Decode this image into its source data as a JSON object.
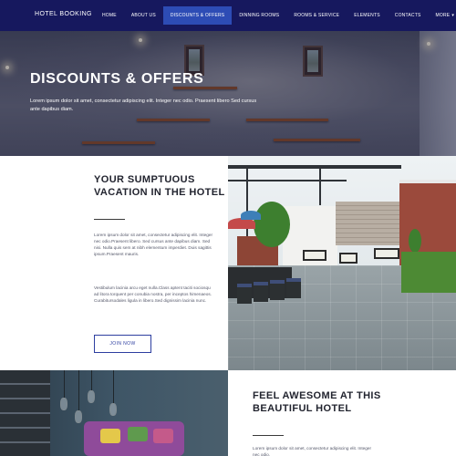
{
  "nav": {
    "brand": "HOTEL BOOKING",
    "items": [
      {
        "label": "HOME"
      },
      {
        "label": "ABOUT US"
      },
      {
        "label": "DISCOUNTS & OFFERS",
        "active": true
      },
      {
        "label": "DINNING ROOMS"
      },
      {
        "label": "ROOMS & SERVICE"
      },
      {
        "label": "ELEMENTS"
      },
      {
        "label": "CONTACTS"
      },
      {
        "label": "MORE"
      }
    ],
    "more_caret": "▾",
    "colors": {
      "bar": "#16185e",
      "active": "#2d4cb5"
    }
  },
  "hero": {
    "title": "DISCOUNTS & OFFERS",
    "text": "Lorem ipsum dolor sit amet, consectetur adipiscing elit. Integer nec odio. Praesent libero Sed cursus ante dapibus diam."
  },
  "section1": {
    "heading": "YOUR SUMPTUOUS VACATION IN THE HOTEL",
    "para1": "Lorem ipsum dolor sit amet, consectetur adipiscing elit. Integer nec odio.Praesent libero. Sed cursus ante dapibus diam. Sed nisi. Nulla quis sem at nibh elementum imperdiet. Duis sagittis ipsum.Praesent mauris.",
    "para2": "Vestibulum lacinia arcu eget nulla.Class aptent taciti sociosqu ad litora torquent per conubia nostra, per inceptos himenaeos. Curabitursodales ligula in libero.Sed dignissim lacinia nunc.",
    "button_label": "JOIN NOW",
    "accent": "#2d3ea0"
  },
  "section2": {
    "heading": "FEEL AWESOME AT THIS BEAUTIFUL HOTEL",
    "para": "Lorem ipsum dolor sit amet, consectetur adipiscing elit. Integer nec odio."
  }
}
